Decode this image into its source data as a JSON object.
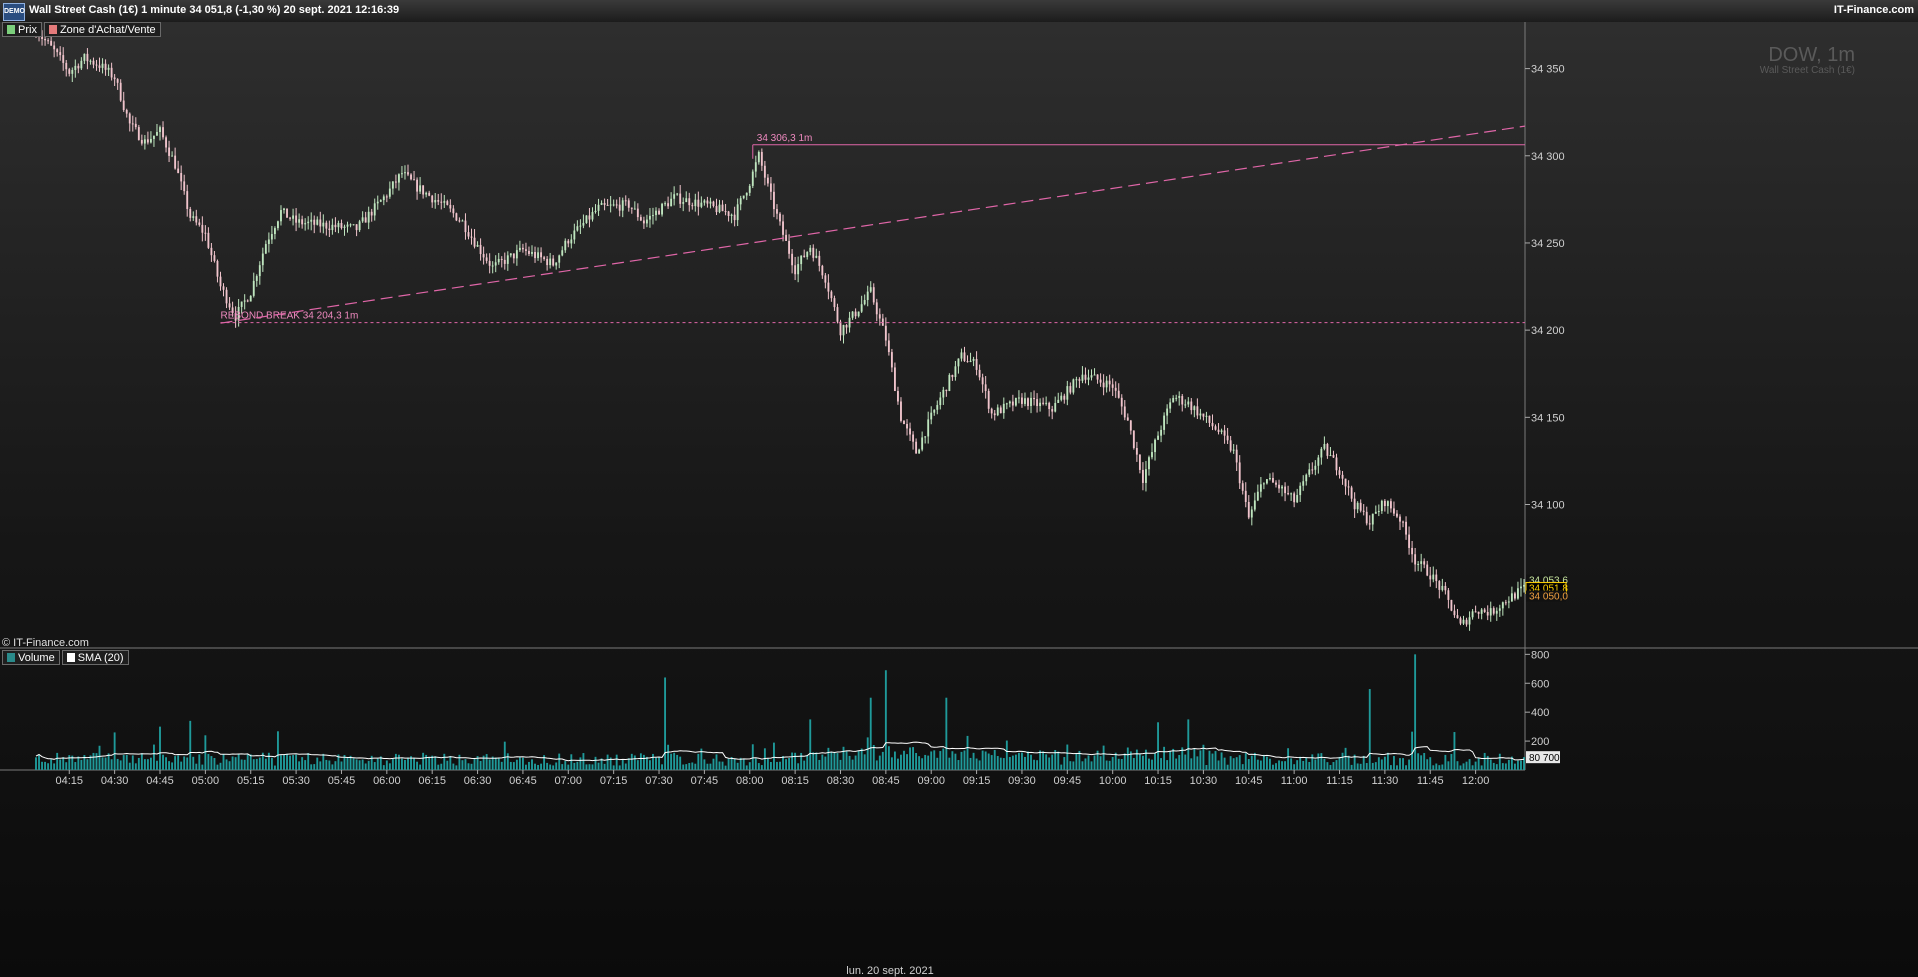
{
  "window": {
    "badge": "DEMO",
    "title": "Wall Street Cash (1€) 1 minute 34 051,8 (-1,30 %) 20 sept. 2021 12:16:39",
    "brand": "IT-Finance.com"
  },
  "legend_price": [
    {
      "label": "Prix",
      "color": "#7ccf7c"
    },
    {
      "label": "Zone d'Achat/Vente",
      "color": "#e47b7b"
    }
  ],
  "legend_volume": [
    {
      "label": "Volume",
      "color": "#2a8a8a"
    },
    {
      "label": "SMA (20)",
      "color": "#ffffff"
    }
  ],
  "watermark": {
    "symbol": "DOW, 1m",
    "name": "Wall Street Cash (1€)"
  },
  "copyright": "© IT-Finance.com",
  "date_label": "lun. 20 sept. 2021",
  "annotations": {
    "resistance": "34 306,3 1m",
    "support": "REBOND BREAK 34 204,3 1m"
  },
  "price_tags": {
    "ask": "34 053,6",
    "last": "34 051,8",
    "bid": "34 050,0"
  },
  "volume_sma_label": "80 700",
  "colors": {
    "up": "#bfe6bf",
    "down": "#f0c4cc",
    "line": "#e066a8",
    "volume": "#1f9a9a",
    "last": "#ffd200"
  },
  "chart_data": [
    {
      "type": "candlestick",
      "title": "DOW, 1m",
      "ylim": [
        34020,
        34375
      ],
      "yticks": [
        "34 350",
        "34 300",
        "34 250",
        "34 200",
        "34 150",
        "34 100"
      ],
      "ytick_values": [
        34350,
        34300,
        34250,
        34200,
        34150,
        34100
      ],
      "xticks": [
        "04:15",
        "04:30",
        "04:45",
        "05:00",
        "05:15",
        "05:30",
        "05:45",
        "06:00",
        "06:15",
        "06:30",
        "06:45",
        "07:00",
        "07:15",
        "07:30",
        "07:45",
        "08:00",
        "08:15",
        "08:30",
        "08:45",
        "09:00",
        "09:15",
        "09:30",
        "09:45",
        "10:00",
        "10:15",
        "10:30",
        "10:45",
        "11:00",
        "11:15",
        "11:30",
        "11:45",
        "12:00"
      ],
      "x_start": "04:04",
      "x_end": "12:16",
      "close_path": [
        [
          "04:04",
          34372
        ],
        [
          "04:10",
          34360
        ],
        [
          "04:15",
          34348
        ],
        [
          "04:20",
          34356
        ],
        [
          "04:25",
          34352
        ],
        [
          "04:30",
          34345
        ],
        [
          "04:35",
          34318
        ],
        [
          "04:40",
          34308
        ],
        [
          "04:45",
          34314
        ],
        [
          "04:50",
          34295
        ],
        [
          "04:55",
          34265
        ],
        [
          "05:00",
          34255
        ],
        [
          "05:05",
          34225
        ],
        [
          "05:10",
          34208
        ],
        [
          "05:15",
          34222
        ],
        [
          "05:20",
          34250
        ],
        [
          "05:25",
          34268
        ],
        [
          "05:30",
          34262
        ],
        [
          "05:40",
          34260
        ],
        [
          "05:50",
          34258
        ],
        [
          "06:00",
          34278
        ],
        [
          "06:05",
          34290
        ],
        [
          "06:10",
          34282
        ],
        [
          "06:20",
          34270
        ],
        [
          "06:25",
          34262
        ],
        [
          "06:30",
          34248
        ],
        [
          "06:35",
          34236
        ],
        [
          "06:45",
          34246
        ],
        [
          "06:55",
          34238
        ],
        [
          "07:00",
          34252
        ],
        [
          "07:10",
          34270
        ],
        [
          "07:20",
          34272
        ],
        [
          "07:25",
          34262
        ],
        [
          "07:35",
          34276
        ],
        [
          "07:45",
          34272
        ],
        [
          "07:55",
          34266
        ],
        [
          "08:00",
          34285
        ],
        [
          "08:03",
          34300
        ],
        [
          "08:06",
          34282
        ],
        [
          "08:10",
          34260
        ],
        [
          "08:15",
          34235
        ],
        [
          "08:20",
          34248
        ],
        [
          "08:25",
          34230
        ],
        [
          "08:30",
          34200
        ],
        [
          "08:35",
          34210
        ],
        [
          "08:40",
          34222
        ],
        [
          "08:45",
          34195
        ],
        [
          "08:50",
          34150
        ],
        [
          "08:55",
          34130
        ],
        [
          "09:00",
          34150
        ],
        [
          "09:05",
          34168
        ],
        [
          "09:10",
          34185
        ],
        [
          "09:15",
          34180
        ],
        [
          "09:20",
          34152
        ],
        [
          "09:30",
          34160
        ],
        [
          "09:40",
          34155
        ],
        [
          "09:50",
          34175
        ],
        [
          "10:00",
          34168
        ],
        [
          "10:05",
          34148
        ],
        [
          "10:10",
          34115
        ],
        [
          "10:15",
          34140
        ],
        [
          "10:20",
          34162
        ],
        [
          "10:25",
          34158
        ],
        [
          "10:35",
          34142
        ],
        [
          "10:40",
          34130
        ],
        [
          "10:45",
          34092
        ],
        [
          "10:50",
          34115
        ],
        [
          "10:55",
          34110
        ],
        [
          "11:00",
          34102
        ],
        [
          "11:05",
          34118
        ],
        [
          "11:10",
          34132
        ],
        [
          "11:15",
          34120
        ],
        [
          "11:20",
          34100
        ],
        [
          "11:25",
          34090
        ],
        [
          "11:30",
          34102
        ],
        [
          "11:35",
          34092
        ],
        [
          "11:40",
          34068
        ],
        [
          "11:45",
          34060
        ],
        [
          "11:50",
          34048
        ],
        [
          "11:55",
          34030
        ],
        [
          "12:00",
          34040
        ],
        [
          "12:05",
          34038
        ],
        [
          "12:10",
          34045
        ],
        [
          "12:16",
          34051.8
        ]
      ],
      "annotations": [
        {
          "kind": "horizontal",
          "value": 34306.3,
          "from": "08:01",
          "label": "34 306,3 1m"
        },
        {
          "kind": "horizontal_dashed",
          "value": 34204.3,
          "from": "05:05",
          "label": "REBOND BREAK 34 204,3 1m"
        },
        {
          "kind": "trendline_dashed",
          "points": [
            [
              "05:05",
              34204
            ],
            [
              "08:12",
              34253
            ]
          ]
        }
      ],
      "last": 34051.8
    },
    {
      "type": "bar",
      "title": "Volume",
      "ylim": [
        0,
        830
      ],
      "yticks": [
        "800",
        "600",
        "400",
        "200"
      ],
      "ytick_values": [
        800,
        600,
        400,
        200
      ],
      "sma_last": 80700,
      "peaks": [
        [
          "04:30",
          260
        ],
        [
          "04:45",
          300
        ],
        [
          "04:55",
          340
        ],
        [
          "05:00",
          240
        ],
        [
          "07:32",
          640
        ],
        [
          "08:05",
          150
        ],
        [
          "08:20",
          350
        ],
        [
          "08:40",
          500
        ],
        [
          "08:45",
          690
        ],
        [
          "09:05",
          500
        ],
        [
          "09:25",
          260
        ],
        [
          "10:15",
          330
        ],
        [
          "10:25",
          350
        ],
        [
          "11:25",
          560
        ],
        [
          "11:40",
          800
        ]
      ]
    }
  ]
}
